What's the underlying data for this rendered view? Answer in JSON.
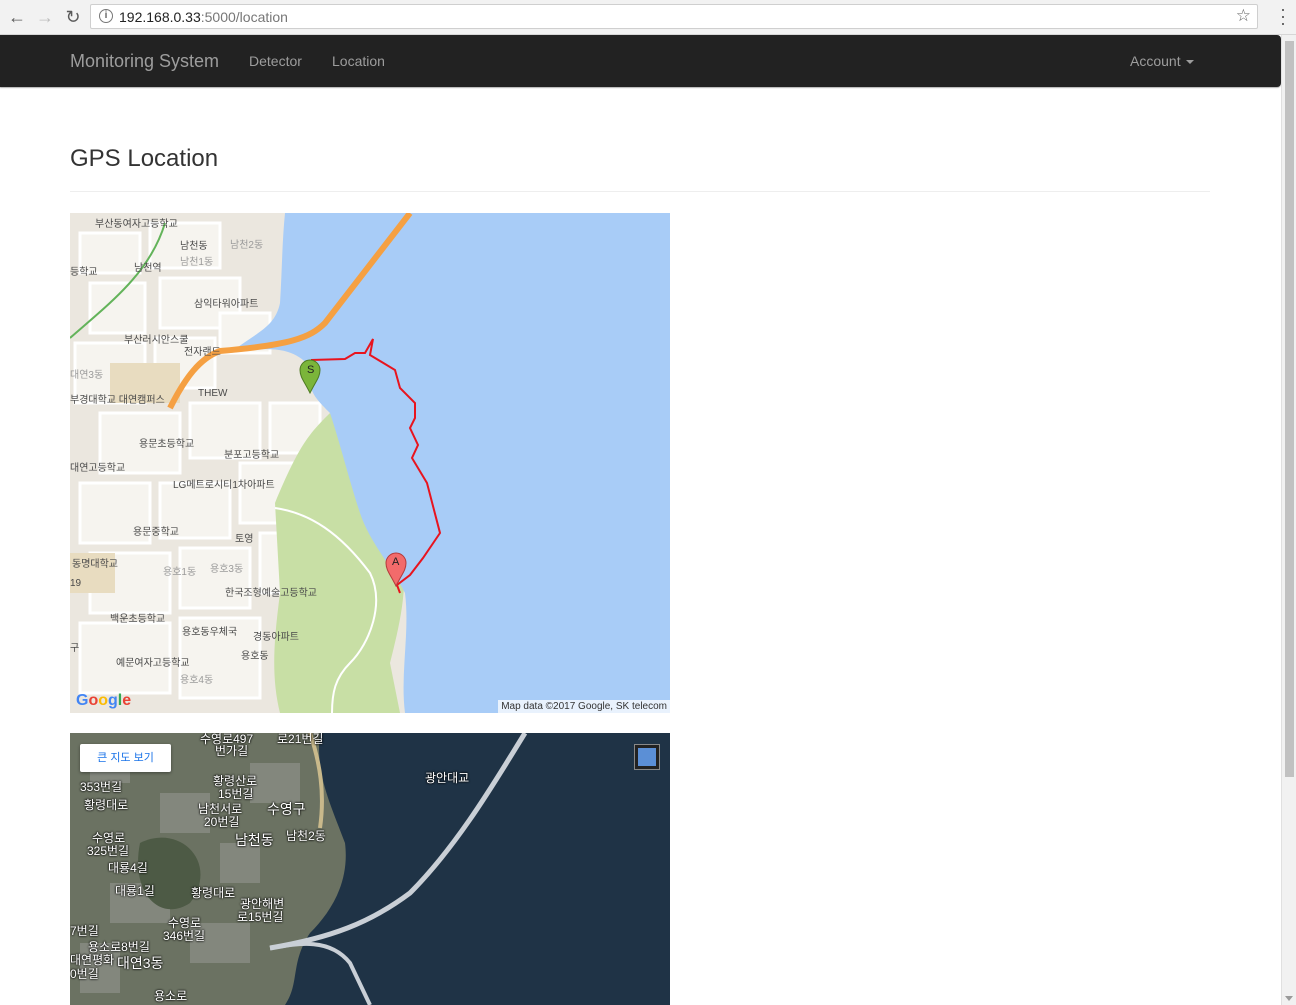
{
  "browser": {
    "url_host": "192.168.0.33",
    "url_path": ":5000/location"
  },
  "navbar": {
    "brand": "Monitoring System",
    "links": [
      "Detector",
      "Location"
    ],
    "account": "Account"
  },
  "main": {
    "title": "GPS Location"
  },
  "map_road": {
    "attribution": "Map data ©2017 Google, SK telecom",
    "marker_start": "S",
    "marker_end": "A",
    "labels": [
      "부산동여자고등학교",
      "남천동",
      "남천2동",
      "남천역",
      "남천1동",
      "등학교",
      "삼익타워아파트",
      "부산러시안스쿨",
      "전자랜드",
      "대연3동",
      "THEW",
      "부경대학교 대연캠퍼스",
      "용문초등학교",
      "분포고등학교",
      "대연고등학교",
      "LG메트로시티1차아파트",
      "용문중학교",
      "토영",
      "동명대학교",
      "용호1동",
      "용호3동",
      "한국조형예술고등학교",
      "백운초등학교",
      "용호동우체국",
      "경동아파트",
      "예문여자고등학교",
      "용호동",
      "용호4동",
      "19",
      "구"
    ]
  },
  "map_sat": {
    "big_map_button": "큰 지도 보기",
    "labels": [
      "수영로497",
      "번가길",
      "로21번길",
      "광안대교",
      "황령산로",
      "15번길",
      "353번길",
      "황령대로",
      "남천서로",
      "20번길",
      "수영구",
      "남천2동",
      "수영로",
      "325번길",
      "남천동",
      "대룡4길",
      "대룡1길",
      "황령대로",
      "광안해변",
      "로15번길",
      "수영로",
      "346번길",
      "용소로8번길",
      "대연3동",
      "7번길",
      "용소로",
      "0번길",
      "대연평화"
    ]
  },
  "colors": {
    "navbar_bg": "#222222",
    "water": "#a8ccf7",
    "route": "#e8141e",
    "marker_start": "#7bb53a",
    "marker_end": "#f26b6b",
    "highway": "#f5a042"
  }
}
